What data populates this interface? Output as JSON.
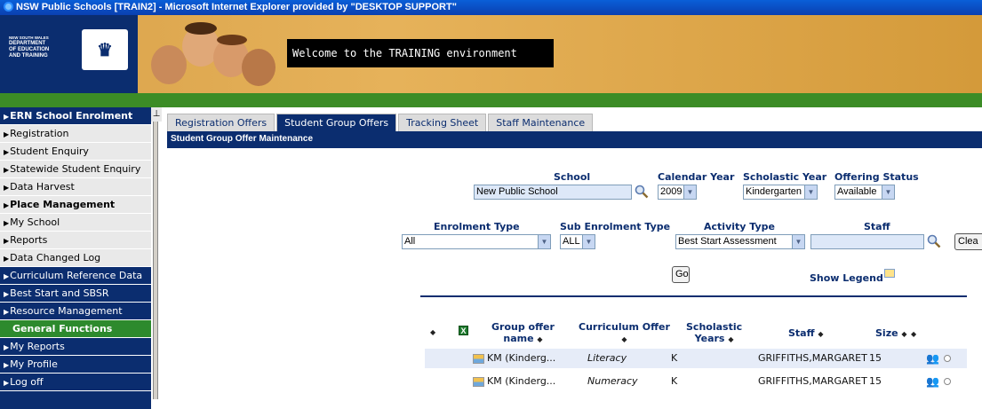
{
  "window": {
    "title": "NSW Public Schools [TRAIN2] - Microsoft Internet Explorer provided by \"DESKTOP SUPPORT\""
  },
  "banner": {
    "dept_lines": [
      "NEW SOUTH WALES",
      "DEPARTMENT",
      "OF EDUCATION",
      "AND TRAINING"
    ],
    "welcome": "Welcome to the TRAINING environment"
  },
  "sidebar": {
    "items": [
      {
        "label": "ERN School Enrolment"
      },
      {
        "label": "Registration"
      },
      {
        "label": "Student Enquiry"
      },
      {
        "label": "Statewide Student Enquiry"
      },
      {
        "label": "Data Harvest"
      },
      {
        "label": "Place Management"
      },
      {
        "label": "My School"
      },
      {
        "label": "Reports"
      },
      {
        "label": "Data Changed Log"
      },
      {
        "label": "Curriculum Reference Data"
      },
      {
        "label": "Best Start and SBSR"
      },
      {
        "label": "Resource Management"
      },
      {
        "label": "General Functions"
      },
      {
        "label": "My Reports"
      },
      {
        "label": "My Profile"
      },
      {
        "label": "Log off"
      }
    ]
  },
  "tabs": [
    {
      "label": "Registration Offers"
    },
    {
      "label": "Student Group Offers"
    },
    {
      "label": "Tracking Sheet"
    },
    {
      "label": "Staff Maintenance"
    }
  ],
  "section_title": "Student Group Offer Maintenance",
  "filters": {
    "school_label": "School",
    "school_value": "New Public School",
    "calendar_year_label": "Calendar Year",
    "calendar_year_value": "2009",
    "scholastic_year_label": "Scholastic Year",
    "scholastic_year_value": "Kindergarten",
    "offering_status_label": "Offering Status",
    "offering_status_value": "Available",
    "enrolment_type_label": "Enrolment Type",
    "enrolment_type_value": "All",
    "sub_enrolment_type_label": "Sub Enrolment Type",
    "sub_enrolment_type_value": "ALL",
    "activity_type_label": "Activity Type",
    "activity_type_value": "Best Start Assessment",
    "staff_label": "Staff",
    "staff_value": "",
    "clear_label": "Clea",
    "go_label": "Go",
    "show_legend_label": "Show Legend"
  },
  "table": {
    "headers": {
      "group_offer": "Group offer",
      "group_offer2": "name",
      "curriculum_offer": "Curriculum Offer",
      "scholastic": "Scholastic",
      "scholastic2": "Years",
      "staff": "Staff",
      "size": "Size"
    },
    "rows": [
      {
        "name": "KM (Kinderg...",
        "curriculum": "Literacy",
        "years": "K",
        "staff": "GRIFFITHS,MARGARET",
        "size": "15"
      },
      {
        "name": "KM (Kinderg...",
        "curriculum": "Numeracy",
        "years": "K",
        "staff": "GRIFFITHS,MARGARET",
        "size": "15"
      }
    ]
  },
  "colors": {
    "navy": "#0b2d6f",
    "green": "#3c8c26",
    "banner": "#e6b25a"
  }
}
